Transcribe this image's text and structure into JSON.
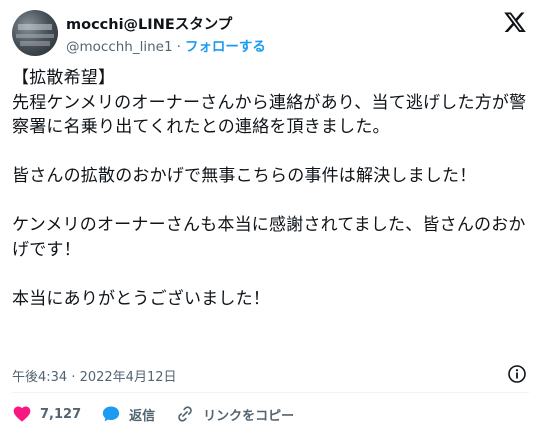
{
  "user": {
    "name": "mocchi@LINEスタンプ",
    "handle": "@mocchh_line1",
    "separator": "·",
    "follow_label": "フォローする"
  },
  "tweet": {
    "text": "【拡散希望】\n先程ケンメリのオーナーさんから連絡があり、当て逃げした方が警察署に名乗り出てくれたとの連絡を頂きました。\n\n皆さんの拡散のおかげで無事こちらの事件は解決しました！\n\nケンメリのオーナーさんも本当に感謝されてました、皆さんのおかげです！\n\n本当にありがとうございました！",
    "timestamp": "午後4:34 · 2022年4月12日"
  },
  "actions": {
    "like_count": "7,127",
    "reply_label": "返信",
    "copy_link_label": "リンクをコピー"
  },
  "colors": {
    "accent": "#1d9bf0",
    "like": "#f91880",
    "secondary_text": "#536471"
  },
  "icons": {
    "brand": "x-logo-icon",
    "info": "info-icon",
    "like": "heart-icon",
    "reply": "speech-bubble-icon",
    "copy_link": "link-icon"
  }
}
